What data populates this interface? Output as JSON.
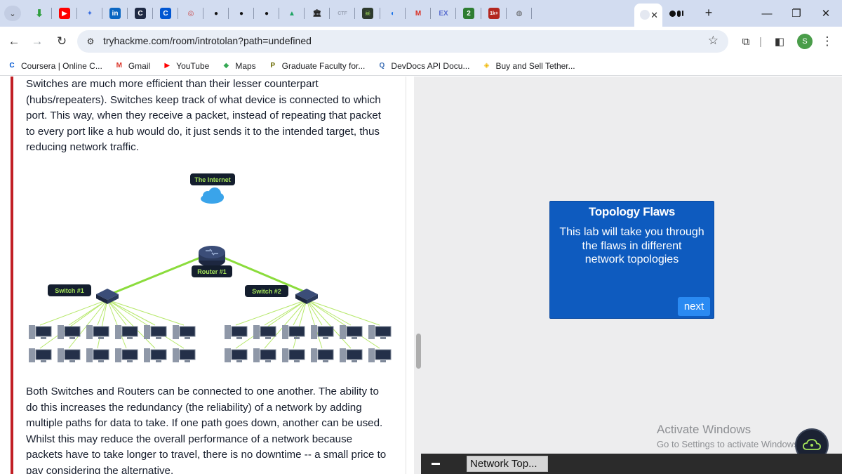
{
  "browser": {
    "tab_icons": [
      {
        "name": "youtube",
        "glyph": "▶",
        "bg": "#ff0000",
        "fg": "#ffffff"
      },
      {
        "name": "gemini",
        "glyph": "✦",
        "bg": "transparent",
        "fg": "#3b6fe0"
      },
      {
        "name": "linkedin",
        "glyph": "in",
        "bg": "#0a66c2",
        "fg": "#ffffff"
      },
      {
        "name": "csdn",
        "glyph": "C",
        "bg": "#1f2a44",
        "fg": "#ffffff"
      },
      {
        "name": "coursera",
        "glyph": "C",
        "bg": "#0056d2",
        "fg": "#ffffff"
      },
      {
        "name": "generic",
        "glyph": "◎",
        "bg": "transparent",
        "fg": "#cc4b4b"
      },
      {
        "name": "github",
        "glyph": "●",
        "bg": "transparent",
        "fg": "#111111"
      },
      {
        "name": "github",
        "glyph": "●",
        "bg": "transparent",
        "fg": "#111111"
      },
      {
        "name": "github",
        "glyph": "●",
        "bg": "transparent",
        "fg": "#111111"
      },
      {
        "name": "drive",
        "glyph": "▲",
        "bg": "transparent",
        "fg": "#1fa463"
      },
      {
        "name": "library",
        "glyph": "🏛",
        "bg": "transparent",
        "fg": "#222222"
      },
      {
        "name": "ctf",
        "glyph": "CTF",
        "bg": "transparent",
        "fg": "#9aa3b5"
      },
      {
        "name": "hacker",
        "glyph": "☠",
        "bg": "#2d3a2d",
        "fg": "#a4e35a"
      },
      {
        "name": "globe",
        "glyph": "◐",
        "bg": "transparent",
        "fg": "#1a73e8"
      },
      {
        "name": "gmail",
        "glyph": "M",
        "bg": "transparent",
        "fg": "#d93025"
      },
      {
        "name": "exploit",
        "glyph": "EX",
        "bg": "transparent",
        "fg": "#5a6fd0"
      },
      {
        "name": "counter",
        "glyph": "2",
        "bg": "#2e7d32",
        "fg": "#ffffff"
      },
      {
        "name": "badge",
        "glyph": "1k+",
        "bg": "#b3261e",
        "fg": "#ffffff"
      },
      {
        "name": "globe",
        "glyph": "◍",
        "bg": "transparent",
        "fg": "#555555"
      }
    ],
    "active_tab_close": "✕",
    "new_tab": "+",
    "window": {
      "minimize": "—",
      "restore": "❐",
      "close": "✕"
    },
    "url": "tryhackme.com/room/introtolan?path=undefined",
    "profile_initial": "S",
    "bookmarks": [
      {
        "label": "Coursera | Online C...",
        "glyph": "C",
        "fg": "#0056d2"
      },
      {
        "label": "Gmail",
        "glyph": "M",
        "fg": "#d93025"
      },
      {
        "label": "YouTube",
        "glyph": "▶",
        "fg": "#ff0000"
      },
      {
        "label": "Maps",
        "glyph": "◆",
        "fg": "#34a853"
      },
      {
        "label": "Graduate Faculty for...",
        "glyph": "P",
        "fg": "#6a6a00"
      },
      {
        "label": "DevDocs API Docu...",
        "glyph": "Q",
        "fg": "#3d6fb5"
      },
      {
        "label": "Buy and Sell Tether...",
        "glyph": "◈",
        "fg": "#f0b90b"
      }
    ]
  },
  "article": {
    "para1": "Switches are much more efficient than their lesser counterpart\n(hubs/repeaters). Switches keep track of what device is connected to which\nport. This way, when they receive a packet, instead of repeating that packet\nto every port like a hub would do, it just sends it to the intended target, thus\nreducing network traffic.",
    "para2": "Both Switches and Routers can be connected to one another. The ability to\ndo this increases the redundancy (the reliability) of a network by adding\nmultiple paths for data to take. If one path goes down, another can be used.\nWhilst this may reduce the overall performance of a network because\npackets have to take longer to travel, there is no downtime -- a small price to\npay considering the alternative."
  },
  "diagram": {
    "internet_label": "The Internet",
    "router_label": "Router #1",
    "switch1_label": "Switch #1",
    "switch2_label": "Switch #2",
    "computers_per_switch": 12
  },
  "lab_card": {
    "title": "Topology Flaws",
    "body": "This lab will take you through\nthe flaws in different\nnetwork topologies",
    "next_label": "next"
  },
  "watermark": {
    "line1": "Activate Windows",
    "line2": "Go to Settings to activate Windows."
  },
  "taskbar": {
    "item_label": "Network Top..."
  }
}
